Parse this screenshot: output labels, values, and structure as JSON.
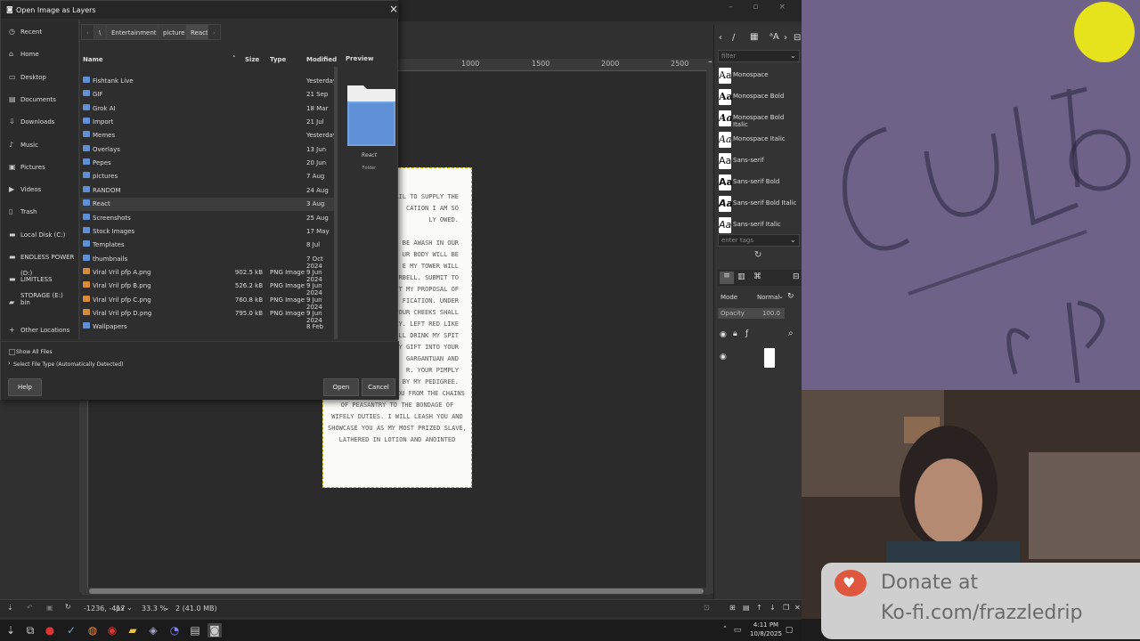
{
  "dialog": {
    "title": "Open Image as Layers",
    "close_label": "×",
    "sidebar": [
      {
        "label": "Recent",
        "icon": "clock-icon"
      },
      {
        "label": "Home",
        "icon": "home-icon"
      },
      {
        "label": "Desktop",
        "icon": "desktop-icon"
      },
      {
        "label": "Documents",
        "icon": "documents-icon"
      },
      {
        "label": "Downloads",
        "icon": "download-icon"
      },
      {
        "label": "Music",
        "icon": "music-icon"
      },
      {
        "label": "Pictures",
        "icon": "pictures-icon"
      },
      {
        "label": "Videos",
        "icon": "video-icon"
      },
      {
        "label": "Trash",
        "icon": "trash-icon"
      },
      {
        "label": "Local Disk (C:)",
        "icon": "drive-icon"
      },
      {
        "label": "ENDLESS POWER (D:)",
        "icon": "drive-icon"
      },
      {
        "label": "LIMITLESS STORAGE (E:)",
        "icon": "drive-icon"
      },
      {
        "label": "bin",
        "icon": "folder-icon"
      }
    ],
    "other_locations": "Other Locations",
    "breadcrumbs": [
      "\\",
      "Entertainment Blok",
      "pictures",
      "React"
    ],
    "columns": {
      "name": "Name",
      "size": "Size",
      "type": "Type",
      "modified": "Modified",
      "preview": "Preview"
    },
    "files": [
      {
        "name": "Fishtank Live",
        "size": "",
        "type": "",
        "modified": "Yesterday",
        "kind": "folder"
      },
      {
        "name": "GIF",
        "size": "",
        "type": "",
        "modified": "21 Sep",
        "kind": "folder"
      },
      {
        "name": "Grok AI",
        "size": "",
        "type": "",
        "modified": "18 Mar",
        "kind": "folder"
      },
      {
        "name": "Import",
        "size": "",
        "type": "",
        "modified": "21 Jul",
        "kind": "folder"
      },
      {
        "name": "Memes",
        "size": "",
        "type": "",
        "modified": "Yesterday",
        "kind": "folder"
      },
      {
        "name": "Overlays",
        "size": "",
        "type": "",
        "modified": "13 Jun",
        "kind": "folder"
      },
      {
        "name": "Pepes",
        "size": "",
        "type": "",
        "modified": "20 Jun",
        "kind": "folder"
      },
      {
        "name": "pictures",
        "size": "",
        "type": "",
        "modified": "7 Aug",
        "kind": "folder"
      },
      {
        "name": "RANDOM",
        "size": "",
        "type": "",
        "modified": "24 Aug",
        "kind": "folder"
      },
      {
        "name": "React",
        "size": "",
        "type": "",
        "modified": "3 Aug",
        "kind": "folder"
      },
      {
        "name": "Screenshots",
        "size": "",
        "type": "",
        "modified": "25 Aug",
        "kind": "folder"
      },
      {
        "name": "Stock Images",
        "size": "",
        "type": "",
        "modified": "17 May",
        "kind": "folder"
      },
      {
        "name": "Templates",
        "size": "",
        "type": "",
        "modified": "8 Jul",
        "kind": "folder"
      },
      {
        "name": "thumbnails",
        "size": "",
        "type": "",
        "modified": "7 Oct 2024",
        "kind": "folder"
      },
      {
        "name": "Viral Vril pfp A.png",
        "size": "902.5 kB",
        "type": "PNG Image",
        "modified": "9 Jun 2024",
        "kind": "image"
      },
      {
        "name": "Viral Vril pfp B.png",
        "size": "526.2 kB",
        "type": "PNG Image",
        "modified": "9 Jun 2024",
        "kind": "image"
      },
      {
        "name": "Viral Vril pfp C.png",
        "size": "760.8 kB",
        "type": "PNG Image",
        "modified": "9 Jun 2024",
        "kind": "image"
      },
      {
        "name": "Viral Vril pfp D.png",
        "size": "795.0 kB",
        "type": "PNG Image",
        "modified": "9 Jun 2024",
        "kind": "image"
      },
      {
        "name": "Wallpapers",
        "size": "",
        "type": "",
        "modified": "8 Feb",
        "kind": "folder"
      }
    ],
    "preview": {
      "name": "React",
      "kind": "Folder"
    },
    "show_all_files": "Show All Files",
    "select_file_type": "Select File Type (Automatically Detected)",
    "help": "Help",
    "open": "Open",
    "cancel": "Cancel"
  },
  "gimp": {
    "ruler_ticks": [
      "1000",
      "1500",
      "2000",
      "2500"
    ],
    "status": {
      "coords": "-1236, -417",
      "unit": "px",
      "zoom": "33.3 %",
      "info": "2 (41.0 MB)"
    },
    "poem_lines": [
      "FAIL TO SUPPLY THE",
      "CATION I AM SO",
      "LY OWED.",
      "",
      "BE AWASH IN OUR",
      "UR BODY WILL BE",
      "E MY TOWER WILL",
      "RBELL. SUBMIT TO",
      "T MY PROPOSAL OF",
      "FICATION. UNDER",
      "YOUR CHEEKS SHALL",
      "SLY. LEFT RED LIKE",
      "ILL DRINK MY SPIT",
      "Y GIFT INTO YOUR",
      "GARGANTUAN AND",
      "R. YOUR PIMPLY",
      "ED BY MY PEDIGREE.",
      "AND I WILL RAISE YOU FROM THE CHAINS",
      "OF PEASANTRY TO THE BONDAGE OF",
      "WIFELY DUTIES. I WILL LEASH YOU AND",
      "SHOWCASE YOU AS MY MOST PRIZED SLAVE,",
      "LATHERED IN LOTION AND ANOINTED"
    ],
    "filter_placeholder": "filter",
    "tags_placeholder": "enter tags",
    "fonts": [
      "Monospace",
      "Monospace Bold",
      "Monospace Bold Italic",
      "Monospace Italic",
      "Sans-serif",
      "Sans-serif Bold",
      "Sans-serif Bold Italic",
      "Sans-serif Italic"
    ],
    "font_sample": "Aa",
    "mode_label": "Mode",
    "mode_value": "Normal",
    "opacity_label": "Opacity",
    "opacity_value": "100.0"
  },
  "overlay": {
    "kofi_line1": "Donate at",
    "kofi_line2": "Ko-fi.com/frazzledrip"
  },
  "taskbar": {
    "time": "4:11 PM",
    "date": "10/8/2025"
  },
  "colors": {
    "folder": "#5f8fd4",
    "accent": "#c8b21a",
    "kofi": "#e0573f"
  }
}
